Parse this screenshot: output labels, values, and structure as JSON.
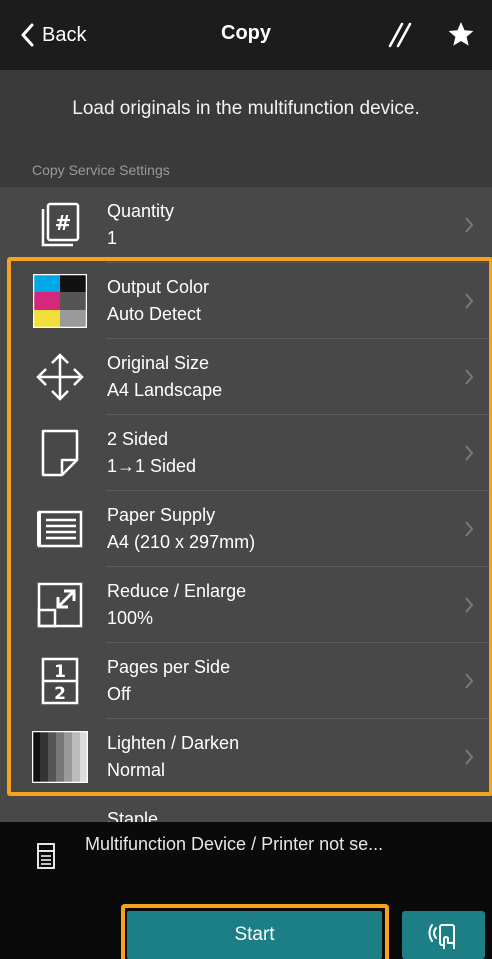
{
  "colors": {
    "accent_teal": "#1c7f85",
    "highlight_orange": "#f6a21a",
    "list_bg": "#484848",
    "content_bg": "#3a3a3a"
  },
  "nav": {
    "back_label": "Back",
    "back_icon": "chevron-left-icon",
    "title": "Copy",
    "edit_icon": "pencil-slash-icon",
    "star_icon": "star-icon"
  },
  "message": "Load originals in the multifunction device.",
  "section_header": "Copy Service Settings",
  "settings": [
    {
      "title": "Quantity",
      "value": "1",
      "icon": "quantity-icon"
    },
    {
      "title": "Output Color",
      "value": "Auto Detect",
      "icon": "output-color-icon"
    },
    {
      "title": "Original Size",
      "value": "A4 Landscape",
      "icon": "original-size-icon"
    },
    {
      "title": "2 Sided",
      "value": "1→1 Sided",
      "icon": "two-sided-icon"
    },
    {
      "title": "Paper Supply",
      "value": "A4 (210 x 297mm)",
      "icon": "paper-supply-icon"
    },
    {
      "title": "Reduce / Enlarge",
      "value": "100%",
      "icon": "reduce-enlarge-icon"
    },
    {
      "title": "Pages per Side",
      "value": "Off",
      "icon": "pages-per-side-icon"
    },
    {
      "title": "Lighten / Darken",
      "value": "Normal",
      "icon": "lighten-darken-icon"
    },
    {
      "title": "Staple",
      "value": "",
      "icon": ""
    }
  ],
  "device": {
    "text": "Multifunction Device / Printer not se...",
    "icon": "printer-icon"
  },
  "start_label": "Start",
  "nfc_icon": "nfc-touch-icon"
}
